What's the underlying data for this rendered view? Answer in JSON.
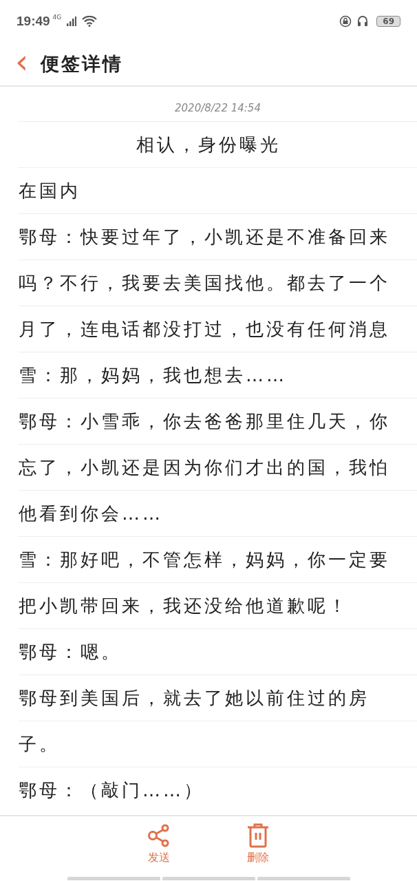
{
  "status_bar": {
    "time": "19:49",
    "network": "4G",
    "battery": "69"
  },
  "header": {
    "back": "‹",
    "title": "便签详情"
  },
  "note": {
    "date": "2020/8/22 14:54",
    "title": "相认，身份曝光",
    "lines": [
      "在国内",
      "鄂母：快要过年了，小凯还是不准备回来",
      "吗？不行，我要去美国找他。都去了一个",
      "月了，连电话都没打过，也没有任何消息",
      "雪：那，妈妈，我也想去……",
      "鄂母：小雪乖，你去爸爸那里住几天，你",
      "忘了，小凯还是因为你们才出的国，我怕",
      "他看到你会……",
      "雪：那好吧，不管怎样，妈妈，你一定要",
      "把小凯带回来，我还没给他道歉呢！",
      "鄂母：嗯。",
      "鄂母到美国后，就去了她以前住过的房",
      "子。",
      "鄂母：（敲门……）"
    ]
  },
  "actions": [
    {
      "kind": "share",
      "label": "发送"
    },
    {
      "kind": "delete",
      "label": "删除"
    }
  ]
}
